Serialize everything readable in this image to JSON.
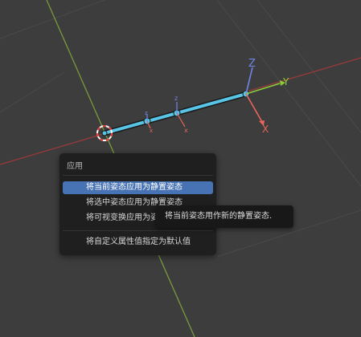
{
  "viewport": {
    "gizmo": {
      "z_label": "Z",
      "y_label": "Y",
      "x_label": "X"
    },
    "bone_labels": [
      "z",
      "x",
      "z",
      "x"
    ],
    "colors": {
      "background": "#3d3d3d",
      "grid_line": "#4a4a4a",
      "y_axis_floor": "#7a9a3a",
      "x_axis_floor": "#9a3a3a",
      "bone": "#58c4e6",
      "gizmo_x": "#e8665c",
      "gizmo_y": "#8ccc3c",
      "gizmo_z": "#6e85e8"
    }
  },
  "menu": {
    "title": "应用",
    "items": [
      {
        "label": "将当前姿态应用为静置姿态",
        "active": true
      },
      {
        "label": "将选中姿态应用为静置姿态",
        "active": false
      },
      {
        "label": "将可视变换应用为姿态",
        "active": false
      },
      {
        "label": "将自定义属性值指定为默认值",
        "active": false
      }
    ]
  },
  "tooltip": {
    "text": "将当前姿态用作新的静置姿态."
  }
}
